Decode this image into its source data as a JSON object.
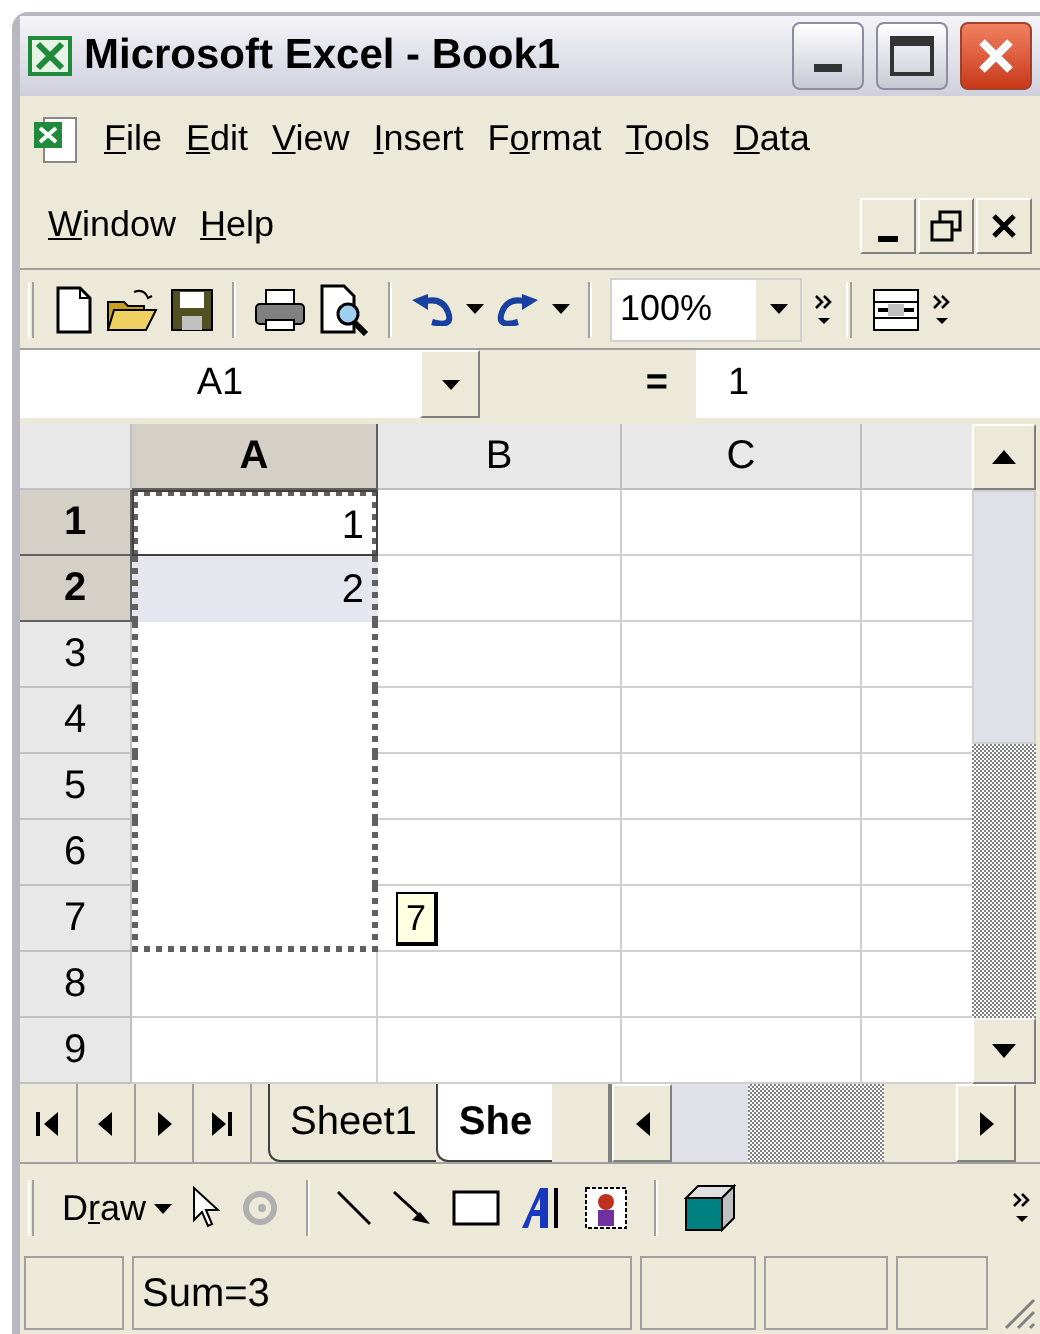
{
  "window": {
    "title": "Microsoft Excel - Book1"
  },
  "menu_bar": [
    {
      "key": "F",
      "after": "ile"
    },
    {
      "key": "E",
      "after": "dit"
    },
    {
      "key": "V",
      "after": "iew"
    },
    {
      "key": "I",
      "after": "nsert"
    },
    {
      "before": "F",
      "key": "o",
      "after": "rmat"
    },
    {
      "key": "T",
      "after": "ools"
    },
    {
      "key": "D",
      "after": "ata"
    },
    {
      "key": "W",
      "after": "indow"
    },
    {
      "key": "H",
      "after": "elp"
    }
  ],
  "toolbar": {
    "zoom": "100%"
  },
  "formula_bar": {
    "name_box": "A1",
    "equals": "=",
    "value": "1"
  },
  "columns": [
    {
      "label": "A",
      "selected": true
    },
    {
      "label": "B",
      "selected": false
    },
    {
      "label": "C",
      "selected": false
    }
  ],
  "rows": [
    {
      "header": "1",
      "selected": true,
      "in_fill_range": true,
      "cells": [
        {
          "value": "1",
          "active": true
        }
      ]
    },
    {
      "header": "2",
      "selected": true,
      "in_fill_range": true,
      "cells": [
        {
          "value": "2",
          "selected": true,
          "active": false
        }
      ]
    },
    {
      "header": "3",
      "selected": false,
      "in_fill_range": true
    },
    {
      "header": "4",
      "selected": false,
      "in_fill_range": true
    },
    {
      "header": "5",
      "selected": false,
      "in_fill_range": true
    },
    {
      "header": "6",
      "selected": false,
      "in_fill_range": true
    },
    {
      "header": "7",
      "selected": false,
      "in_fill_range": true
    },
    {
      "header": "8",
      "selected": false,
      "in_fill_range": false
    },
    {
      "header": "9",
      "selected": false,
      "in_fill_range": false
    }
  ],
  "fill_tooltip": "7",
  "sheet_tabs": [
    {
      "label": "Sheet1",
      "selected": false
    },
    {
      "label": "She",
      "selected": true
    }
  ],
  "drawing_toolbar": {
    "menu": {
      "before": "D",
      "key": "r",
      "after": "aw"
    }
  },
  "status_bar": {
    "text": "Sum=3"
  }
}
